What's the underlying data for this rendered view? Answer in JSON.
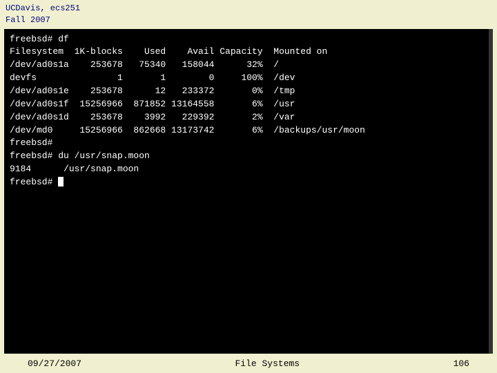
{
  "header": {
    "line1": "UCDavis, ecs251",
    "line2": "Fall 2007"
  },
  "terminal": {
    "lines": [
      "freebsd# df",
      "Filesystem  1K-blocks    Used    Avail Capacity  Mounted on",
      "/dev/ad0s1a    253678   75340   158044      32%  /",
      "devfs               1       1        0     100%  /dev",
      "/dev/ad0s1e    253678      12   233372       0%  /tmp",
      "/dev/ad0s1f  15256966  871852 13164558       6%  /usr",
      "/dev/ad0s1d    253678    3992   229392       2%  /var",
      "/dev/md0     15256966  862668 13173742       6%  /backups/usr/moon",
      "freebsd# ",
      "freebsd# du /usr/snap.moon",
      "9184      /usr/snap.moon",
      "freebsd# "
    ],
    "has_cursor": true
  },
  "footer": {
    "left": "09/27/2007",
    "center": "File Systems",
    "right": "106"
  }
}
